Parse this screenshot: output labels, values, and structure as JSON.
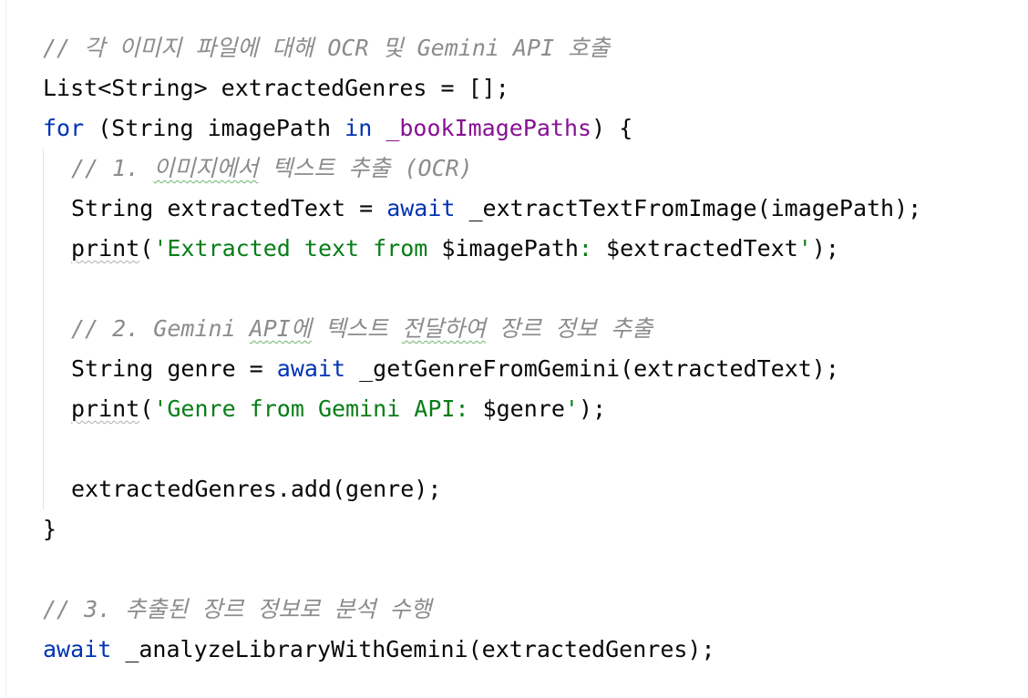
{
  "code": {
    "lines": [
      {
        "indent": 0,
        "tokens": [
          {
            "text": "// 각 이미지 파일에 대해 OCR 및 Gemini API 호출",
            "cls": "comment"
          }
        ]
      },
      {
        "indent": 0,
        "tokens": [
          {
            "text": "List<String> extractedGenres = [];",
            "cls": "plain"
          }
        ]
      },
      {
        "indent": 0,
        "tokens": [
          {
            "text": "for",
            "cls": "keyword"
          },
          {
            "text": " (String imagePath ",
            "cls": "plain"
          },
          {
            "text": "in",
            "cls": "keyword"
          },
          {
            "text": " ",
            "cls": "plain"
          },
          {
            "text": "_bookImagePaths",
            "cls": "field"
          },
          {
            "text": ") {",
            "cls": "plain"
          }
        ]
      },
      {
        "indent": 1,
        "tokens": [
          {
            "text": "// 1. ",
            "cls": "comment"
          },
          {
            "text": "이미지에서",
            "cls": "comment squiggle"
          },
          {
            "text": " 텍스트 추출 (OCR)",
            "cls": "comment"
          }
        ]
      },
      {
        "indent": 1,
        "tokens": [
          {
            "text": "String extractedText = ",
            "cls": "plain"
          },
          {
            "text": "await",
            "cls": "keyword"
          },
          {
            "text": " _extractTextFromImage(imagePath);",
            "cls": "plain"
          }
        ]
      },
      {
        "indent": 1,
        "tokens": [
          {
            "text": "print",
            "cls": "plain squiggle-gray"
          },
          {
            "text": "(",
            "cls": "plain"
          },
          {
            "text": "'Extracted text from ",
            "cls": "string"
          },
          {
            "text": "$imagePath",
            "cls": "plain"
          },
          {
            "text": ": ",
            "cls": "string"
          },
          {
            "text": "$extractedText",
            "cls": "plain"
          },
          {
            "text": "'",
            "cls": "string"
          },
          {
            "text": ");",
            "cls": "plain"
          }
        ]
      },
      {
        "indent": 1,
        "tokens": []
      },
      {
        "indent": 1,
        "tokens": [
          {
            "text": "// 2. Gemini ",
            "cls": "comment"
          },
          {
            "text": "API에",
            "cls": "comment squiggle"
          },
          {
            "text": " 텍스트 ",
            "cls": "comment"
          },
          {
            "text": "전달하여",
            "cls": "comment squiggle"
          },
          {
            "text": " 장르 정보 추출",
            "cls": "comment"
          }
        ]
      },
      {
        "indent": 1,
        "tokens": [
          {
            "text": "String genre = ",
            "cls": "plain"
          },
          {
            "text": "await",
            "cls": "keyword"
          },
          {
            "text": " _getGenreFromGemini(extractedText);",
            "cls": "plain"
          }
        ]
      },
      {
        "indent": 1,
        "tokens": [
          {
            "text": "print",
            "cls": "plain squiggle-gray"
          },
          {
            "text": "(",
            "cls": "plain"
          },
          {
            "text": "'Genre from Gemini API: ",
            "cls": "string"
          },
          {
            "text": "$genre",
            "cls": "plain"
          },
          {
            "text": "'",
            "cls": "string"
          },
          {
            "text": ");",
            "cls": "plain"
          }
        ]
      },
      {
        "indent": 1,
        "tokens": []
      },
      {
        "indent": 1,
        "tokens": [
          {
            "text": "extractedGenres.add(genre);",
            "cls": "plain"
          }
        ]
      },
      {
        "indent": 0,
        "tokens": [
          {
            "text": "}",
            "cls": "plain"
          }
        ]
      },
      {
        "indent": 0,
        "tokens": []
      },
      {
        "indent": 0,
        "tokens": [
          {
            "text": "// 3. 추출된 장르 정보로 분석 수행",
            "cls": "comment"
          }
        ]
      },
      {
        "indent": 0,
        "tokens": [
          {
            "text": "await",
            "cls": "keyword"
          },
          {
            "text": " _analyzeLibraryWithGemini(extractedGenres);",
            "cls": "plain"
          }
        ]
      }
    ]
  }
}
